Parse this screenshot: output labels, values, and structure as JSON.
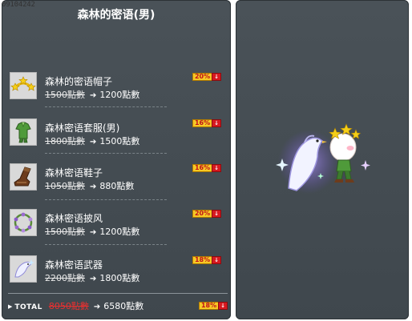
{
  "item_id": "09104242",
  "title": "森林的密语(男)",
  "items": [
    {
      "name": "森林的密语帽子",
      "old_price": "1500點數",
      "new_price": "1200點數",
      "discount": "20%",
      "icon": "star-crown-hat-icon"
    },
    {
      "name": "森林密语套服(男)",
      "old_price": "1800點數",
      "new_price": "1500點數",
      "discount": "16%",
      "icon": "green-outfit-icon"
    },
    {
      "name": "森林密语鞋子",
      "old_price": "1050點數",
      "new_price": "880點數",
      "discount": "16%",
      "icon": "brown-boot-icon"
    },
    {
      "name": "森林密语披风",
      "old_price": "1500點數",
      "new_price": "1200點數",
      "discount": "20%",
      "icon": "flower-wreath-cape-icon"
    },
    {
      "name": "森林密语武器",
      "old_price": "2200點數",
      "new_price": "1800點數",
      "discount": "18%",
      "icon": "white-bird-weapon-icon"
    }
  ],
  "total": {
    "label": "TOTAL",
    "old_price": "8050點數",
    "new_price": "6580點數",
    "discount": "18%"
  },
  "arrow_symbol": "➔",
  "down_symbol": "↓",
  "colors": {
    "panel_bg": "#4a5258",
    "badge_yellow": "#f6c825",
    "badge_red": "#d71920",
    "total_old_price": "#e83030"
  },
  "preview": {
    "icon": "character-with-white-bird-icon"
  }
}
